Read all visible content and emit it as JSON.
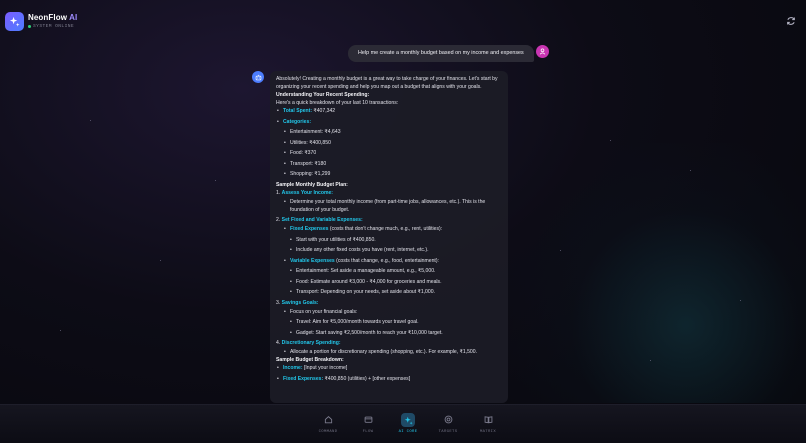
{
  "app": {
    "brand": "NeonFlow",
    "brand_suffix": "AI",
    "status": "SYSTEM ONLINE",
    "accent": "#22c7ea"
  },
  "chat": {
    "user_message": "Help me create a monthly budget based on my income and expenses",
    "ai": {
      "intro": "Absolutely! Creating a monthly budget is a great way to take charge of your finances. Let's start by organizing your recent spending and help you map out a budget that aligns with your goals.",
      "h_understanding": "Understanding Your Recent Spending:",
      "breakdown_intro": "Here's a quick breakdown of your last 10 transactions:",
      "total_spent_label": "Total Spent:",
      "total_spent_value": " ₹407,342",
      "categories_label": "Categories:",
      "categories": [
        "Entertainment: ₹4,643",
        "Utilities: ₹400,850",
        "Food: ₹370",
        "Transport: ₹180",
        "Shopping: ₹1,299"
      ],
      "h_sample_plan": "Sample Monthly Budget Plan:",
      "s1_num": "1. ",
      "s1_title": "Assess Your Income:",
      "s1_item": "Determine your total monthly income (from part-time jobs, allowances, etc.). This is the foundation of your budget.",
      "s2_num": "2. ",
      "s2_title": "Set Fixed and Variable Expenses:",
      "fixed_label": "Fixed Expenses",
      "fixed_desc": " (costs that don't change much, e.g., rent, utilities):",
      "fixed_items": [
        "Start with your utilities of ₹400,850.",
        "Include any other fixed costs you have (rent, internet, etc.)."
      ],
      "variable_label": "Variable Expenses",
      "variable_desc": " (costs that change, e.g., food, entertainment):",
      "variable_items": [
        "Entertainment: Set aside a manageable amount, e.g., ₹5,000.",
        "Food: Estimate around ₹3,000 - ₹4,000 for groceries and meals.",
        "Transport: Depending on your needs, set aside about ₹1,000."
      ],
      "s3_num": "3. ",
      "s3_title": "Savings Goals:",
      "s3_item": "Focus on your financial goals:",
      "s3_subitems": [
        "Travel: Aim for ₹5,000/month towards your travel goal.",
        "Gadget: Start saving ₹2,500/month to reach your ₹10,000 target."
      ],
      "s4_num": "4. ",
      "s4_title": "Discretionary Spending:",
      "s4_item": "Allocate a portion for discretionary spending (shopping, etc.). For example, ₹1,500.",
      "h_breakdown": "Sample Budget Breakdown:",
      "income_label": "Income:",
      "income_value": " [Input your income]",
      "fixed2_label": "Fixed Expenses:",
      "fixed2_value": " ₹400,850 (utilities) + [other expenses]"
    }
  },
  "nav": {
    "items": [
      {
        "label": "COMMAND",
        "icon": "home-icon"
      },
      {
        "label": "FLOW",
        "icon": "wallet-icon"
      },
      {
        "label": "AI CORE",
        "icon": "sparkle-icon",
        "active": true
      },
      {
        "label": "TARGETS",
        "icon": "target-icon"
      },
      {
        "label": "MATRIX",
        "icon": "book-icon"
      }
    ]
  }
}
